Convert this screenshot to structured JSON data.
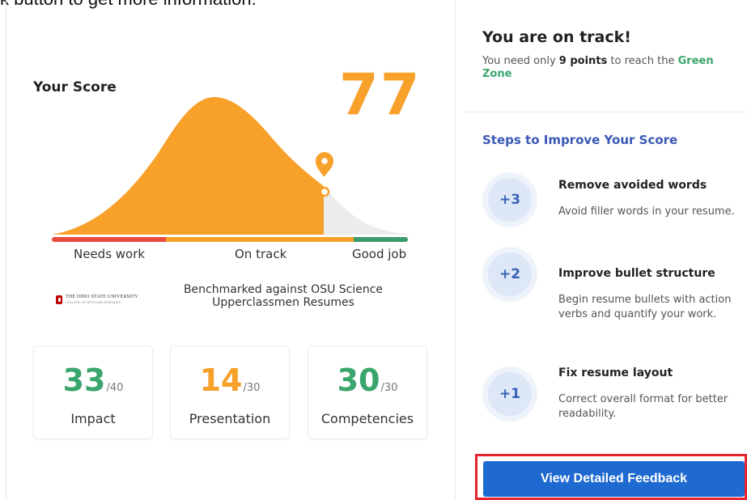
{
  "caption": "k button to get more information.",
  "score": {
    "title": "Your Score",
    "value": "77",
    "zones": [
      "Needs work",
      "On track",
      "Good job"
    ],
    "benchmark": "Benchmarked against OSU Science Upperclassmen Resumes",
    "institution": {
      "name": "THE OHIO STATE UNIVERSITY",
      "sub": "COLLEGE OF ARTS AND SCIENCES"
    }
  },
  "metrics": [
    {
      "value": "33",
      "max": "/40",
      "label": "Impact",
      "color": "#3aa56c"
    },
    {
      "value": "14",
      "max": "/30",
      "label": "Presentation",
      "color": "#f7a02a"
    },
    {
      "value": "30",
      "max": "/30",
      "label": "Competencies",
      "color": "#3aa56c"
    }
  ],
  "status": {
    "title": "You are on track!",
    "need_prefix": "You need only ",
    "need_points": "9 points",
    "need_mid": " to reach the ",
    "need_zone": "Green Zone"
  },
  "steps": {
    "title": "Steps to Improve Your Score",
    "items": [
      {
        "points": "+3",
        "title": "Remove avoided words",
        "desc": "Avoid filler words in your resume."
      },
      {
        "points": "+2",
        "title": "Improve bullet structure",
        "desc": "Begin resume bullets with action verbs and quantify your work."
      },
      {
        "points": "+1",
        "title": "Fix resume layout",
        "desc": "Correct overall format for better readability."
      }
    ]
  },
  "cta": {
    "label": "View Detailed Feedback"
  },
  "colors": {
    "orange": "#f7a02a",
    "green": "#3aa56c",
    "red": "#e94b3c",
    "blue": "#1f6ad0",
    "highlight": "#e8252e"
  }
}
